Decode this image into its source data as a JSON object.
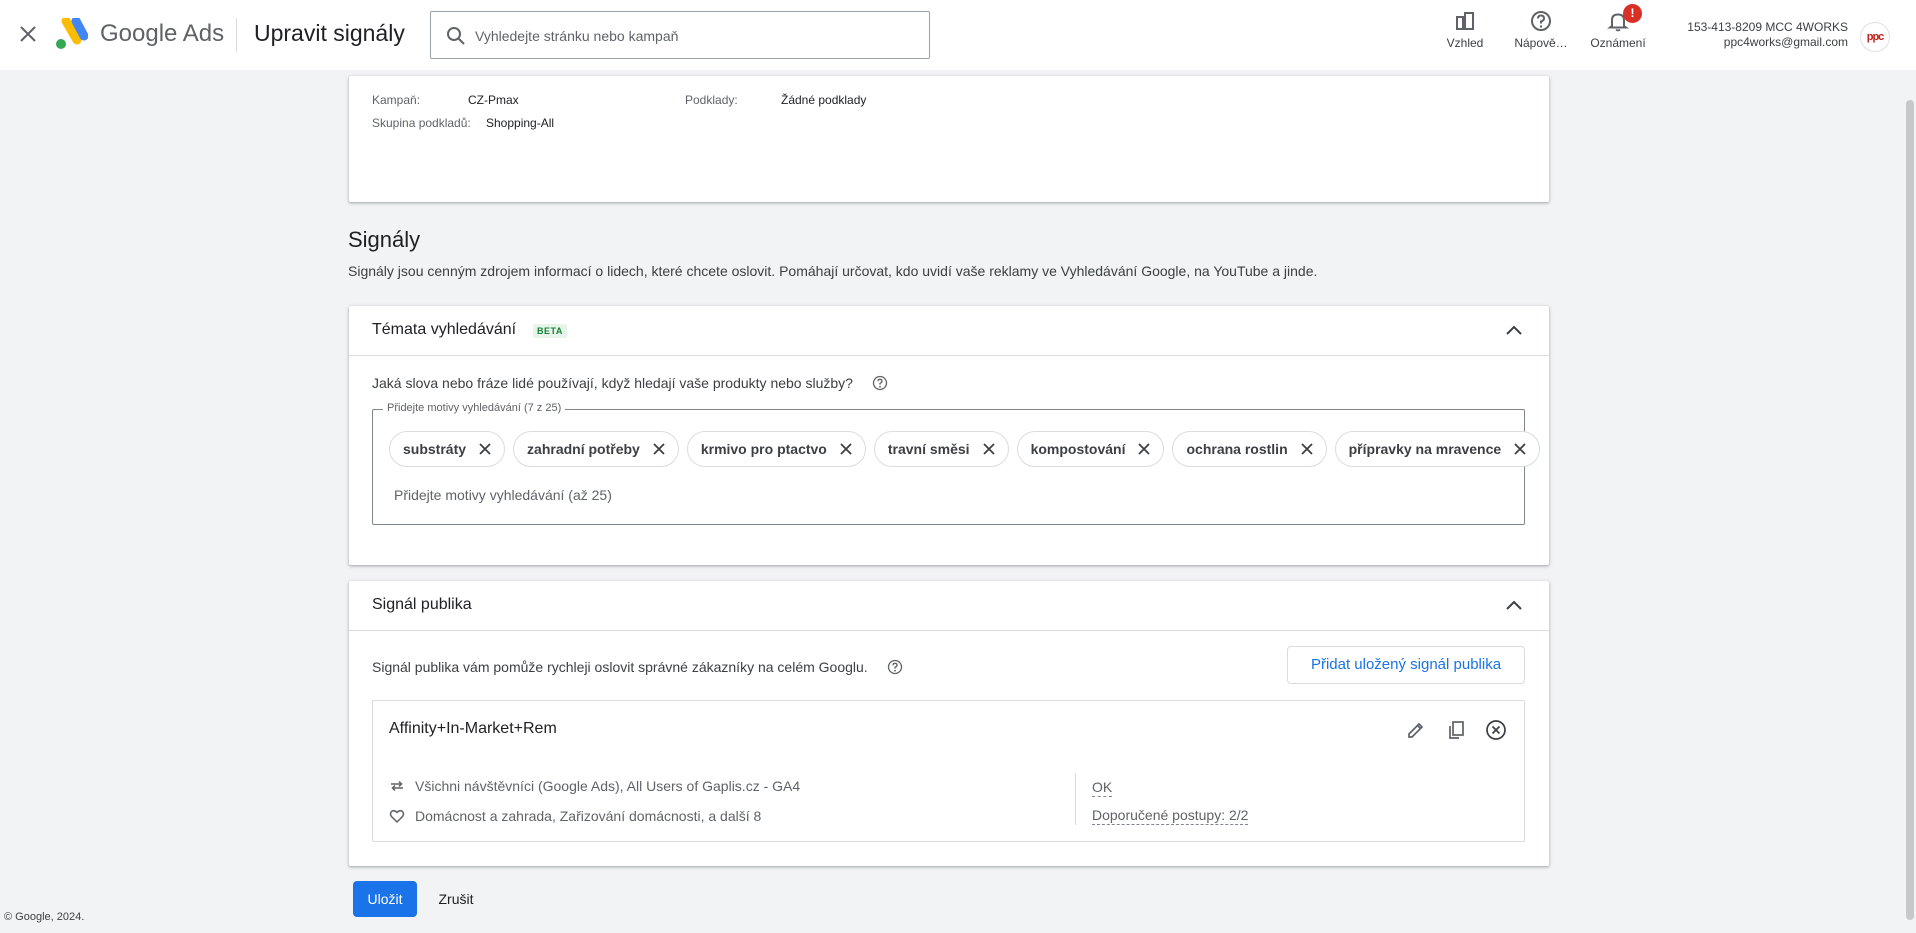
{
  "header": {
    "logo_text": "Google Ads",
    "page_title": "Upravit signály",
    "search_placeholder": "Vyhledejte stránku nebo kampaň",
    "tools": [
      {
        "label": "Vzhled",
        "icon": "appearance-icon"
      },
      {
        "label": "Nápově…",
        "icon": "help-icon"
      },
      {
        "label": "Oznámení",
        "icon": "bell-icon",
        "badge": "!"
      }
    ],
    "account_id": "153-413-8209 MCC 4WORKS",
    "account_email": "ppc4works@gmail.com",
    "avatar_text": "ppc"
  },
  "summary": {
    "campaign_label": "Kampaň:",
    "campaign_value": "CZ-Pmax",
    "asset_group_label": "Skupina podkladů:",
    "asset_group_value": "Shopping-All",
    "assets_label": "Podklady:",
    "assets_value": "Žádné podklady"
  },
  "signals": {
    "title": "Signály",
    "description": "Signály jsou cenným zdrojem informací o lidech, které chcete oslovit. Pomáhají určovat, kdo uvidí vaše reklamy ve Vyhledávání Google, na YouTube a jinde."
  },
  "search_topics": {
    "title": "Témata vyhledávání",
    "badge": "BETA",
    "question": "Jaká slova nebo fráze lidé používají, když hledají vaše produkty nebo služby?",
    "field_label": "Přidejte motivy vyhledávání (7 z 25)",
    "chips": [
      "substráty",
      "zahradní potřeby",
      "krmivo pro ptactvo",
      "travní směsi",
      "kompostování",
      "ochrana rostlin",
      "přípravky na mravence"
    ],
    "input_placeholder": "Přidejte motivy vyhledávání (až 25)"
  },
  "audience": {
    "title": "Signál publika",
    "description": "Signál publika vám pomůže rychleji oslovit správné zákazníky na celém Googlu.",
    "add_saved_button": "Přidat uložený signál publika",
    "signal_name": "Affinity+In-Market+Rem",
    "row1": "Všichni návštěvníci (Google Ads), All Users of Gaplis.cz - GA4",
    "row2": "Domácnost a zahrada, Zařizování domácnosti, a další 8",
    "status": "OK",
    "best_practices": "Doporučené postupy: 2/2"
  },
  "actions": {
    "save": "Uložit",
    "cancel": "Zrušit"
  },
  "footer": "© Google, 2024.",
  "colors": {
    "accent": "#1a73e8",
    "notification_badge": "#d93025",
    "beta_badge": "#188038"
  }
}
